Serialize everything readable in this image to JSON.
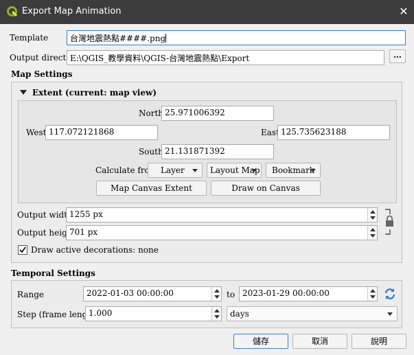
{
  "window": {
    "title": "Export Map Animation"
  },
  "template": {
    "label": "Template",
    "value": "台灣地震熱點####.png"
  },
  "output_directory": {
    "label": "Output directory",
    "value": "E:\\QGIS_教學資料\\QGIS-台灣地震熱點\\Export",
    "browse_label": "…"
  },
  "map_settings": {
    "title": "Map Settings",
    "extent": {
      "title": "Extent (current: map view)",
      "north": {
        "label": "North",
        "value": "25.971006392"
      },
      "west": {
        "label": "West",
        "value": "117.072121868"
      },
      "east": {
        "label": "East",
        "value": "125.735623188"
      },
      "south": {
        "label": "South",
        "value": "21.131871392"
      },
      "calculate_from": {
        "label": "Calculate from",
        "layer": "Layer",
        "layout_map": "Layout Map",
        "bookmark": "Bookmark"
      },
      "map_canvas_extent": "Map Canvas Extent",
      "draw_on_canvas": "Draw on Canvas"
    },
    "output_width": {
      "label": "Output width",
      "value": "1255 px"
    },
    "output_height": {
      "label": "Output height",
      "value": "701 px"
    },
    "decorations": {
      "label": "Draw active decorations: none",
      "checked": true
    }
  },
  "temporal_settings": {
    "title": "Temporal Settings",
    "range": {
      "label": "Range",
      "start": "2022-01-03 00:00:00",
      "to_label": "to",
      "end": "2023-01-29 00:00:00"
    },
    "step": {
      "label": "Step (frame length)",
      "value": "1.000",
      "unit": "days"
    }
  },
  "buttons": {
    "save": "儲存",
    "cancel": "取消",
    "help": "說明"
  },
  "colors": {
    "titlebar": "#3c3c3c",
    "focus": "#2c7fc9",
    "refresh": "#2f7fcf"
  }
}
